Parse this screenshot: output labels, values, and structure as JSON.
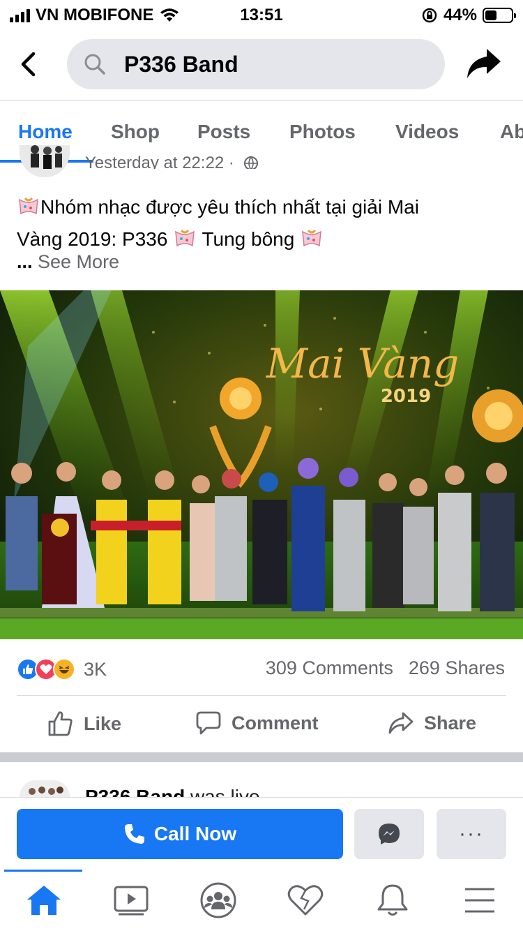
{
  "status_bar": {
    "carrier": "VN MOBIFONE",
    "time": "13:51",
    "battery": "44%",
    "battery_level": 0.44
  },
  "search": {
    "query": "P336 Band"
  },
  "tabs": [
    {
      "label": "Home",
      "active": true
    },
    {
      "label": "Shop"
    },
    {
      "label": "Posts"
    },
    {
      "label": "Photos"
    },
    {
      "label": "Videos"
    },
    {
      "label": "Ab"
    }
  ],
  "post": {
    "meta": "Yesterday at 22:22 ·",
    "text_line1": "Nhóm nhạc được yêu thích nhất tại giải Mai",
    "text_line2a": "Vàng 2019: P336 ",
    "text_line2b": " Tung bông ",
    "see_more_prefix": "... ",
    "see_more": "See More",
    "reactions_count": "3K",
    "comments": "309 Comments",
    "shares": "269 Shares",
    "actions": {
      "like": "Like",
      "comment": "Comment",
      "share": "Share"
    }
  },
  "next_post": {
    "author": "P336 Band",
    "status": " was live",
    "more": "···"
  },
  "cta": {
    "call_now": "Call Now",
    "more": "···"
  },
  "colors": {
    "brand": "#1877f2",
    "secondary_text": "#65676b",
    "button_gray": "#e4e6eb"
  },
  "icons": [
    "back-icon",
    "search-icon",
    "share-arrow-icon",
    "globe-icon",
    "like-icon",
    "love-icon",
    "haha-icon",
    "comment-icon",
    "share-icon",
    "phone-icon",
    "messenger-icon",
    "home-icon",
    "watch-icon",
    "groups-icon",
    "dating-icon",
    "notifications-icon",
    "menu-icon"
  ]
}
